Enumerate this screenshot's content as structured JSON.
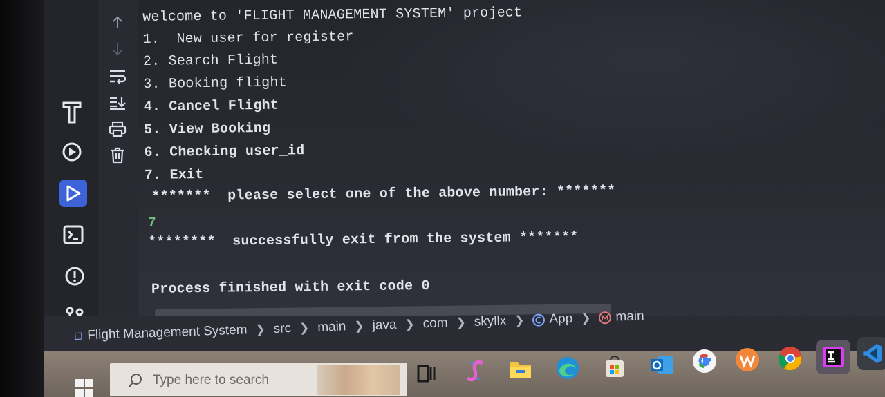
{
  "console": {
    "lines": [
      "welcome to 'FLIGHT MANAGEMENT SYSTEM' project",
      "1.  New user for register",
      "2. Search Flight",
      "3. Booking flight",
      "4. Cancel Flight",
      "5. View Booking",
      "6. Checking user_id",
      "7. Exit",
      "*******  please select one of the above number: *******",
      "7",
      "********  successfully exit from the system *******",
      "Process finished with exit code 0"
    ]
  },
  "breadcrumb": {
    "project": "Flight Management System",
    "path": [
      "src",
      "main",
      "java",
      "com",
      "skyllx"
    ],
    "class_name": "App",
    "method_name": "main"
  },
  "taskbar": {
    "search_placeholder": "Type here to search"
  },
  "icons": {
    "tool_strip": [
      "build-icon",
      "services-icon",
      "run-icon",
      "terminal-icon",
      "problems-icon",
      "git-icon"
    ],
    "console_toolbar": [
      "arrow-up-icon",
      "arrow-down-icon",
      "soft-wrap-icon",
      "scroll-to-end-icon",
      "print-icon",
      "trash-icon"
    ],
    "taskbar_apps": [
      "task-view-icon",
      "copilot-icon",
      "file-explorer-icon",
      "edge-icon",
      "store-icon",
      "outlook-icon",
      "google-icon",
      "wps-icon",
      "chrome-icon",
      "intellij-icon",
      "vscode-icon"
    ]
  },
  "colors": {
    "accent": "#3d63d8",
    "console_text": "#e2e2ea",
    "user_input": "#6fc07a"
  }
}
